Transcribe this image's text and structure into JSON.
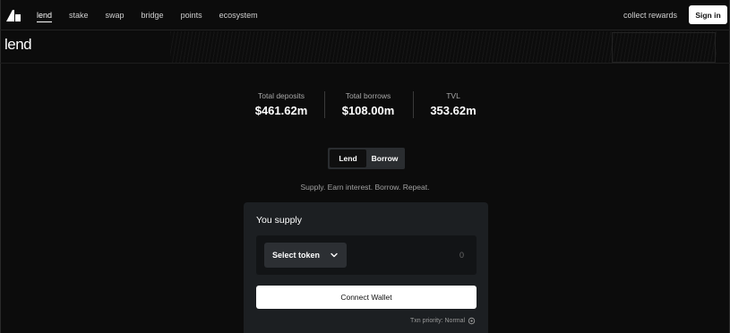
{
  "nav": {
    "links": [
      "lend",
      "stake",
      "swap",
      "bridge",
      "points",
      "ecosystem"
    ],
    "active_index": 0,
    "collect_rewards": "collect rewards",
    "sign_in": "Sign in"
  },
  "page": {
    "title": "lend"
  },
  "stats": [
    {
      "label": "Total deposits",
      "value": "$461.62m"
    },
    {
      "label": "Total borrows",
      "value": "$108.00m"
    },
    {
      "label": "TVL",
      "value": "353.62m"
    }
  ],
  "toggle": {
    "lend": "Lend",
    "borrow": "Borrow",
    "active": "lend"
  },
  "tagline": "Supply. Earn interest. Borrow. Repeat.",
  "card": {
    "title": "You supply",
    "select_token": "Select token",
    "amount_placeholder": "0",
    "connect_wallet": "Connect Wallet",
    "txn_priority": "Txn priority: Normal"
  },
  "icons": {
    "logo": "brand-logo-icon",
    "chevron": "chevron-down-icon",
    "settings": "gear-icon"
  }
}
